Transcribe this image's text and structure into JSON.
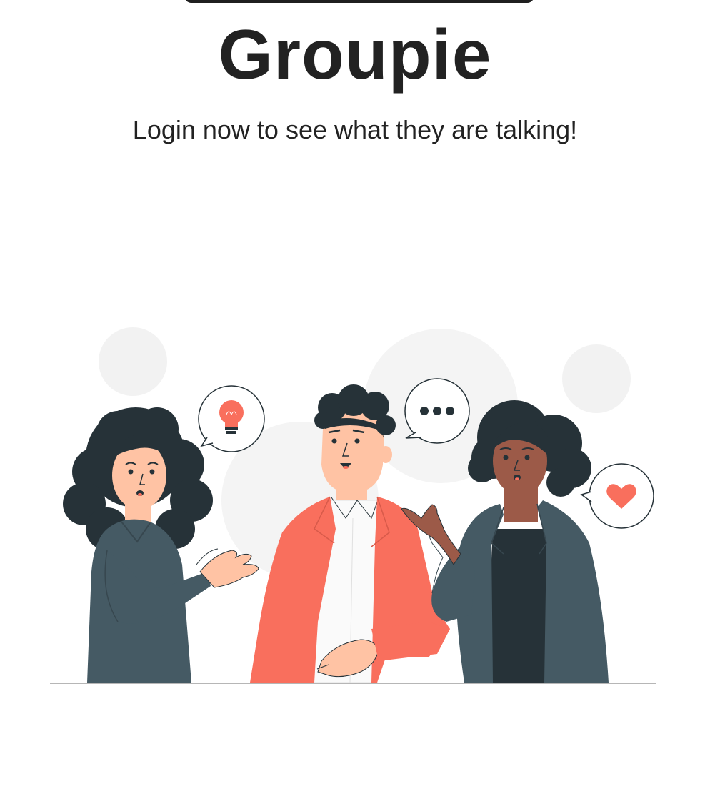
{
  "app": {
    "title": "Groupie",
    "subtitle": "Login now to see what they are talking!"
  },
  "illustration": {
    "subject": "three people talking",
    "bubbles": [
      "lightbulb-icon",
      "ellipsis-icon",
      "heart-icon"
    ]
  },
  "colors": {
    "accent": "#F96F5D",
    "dark_clothing": "#455A64",
    "hair": "#263238",
    "skin_light": "#FFC3A4",
    "skin_dark": "#9C5A48",
    "background_circles": "#F2F2F2",
    "text": "#222222"
  }
}
